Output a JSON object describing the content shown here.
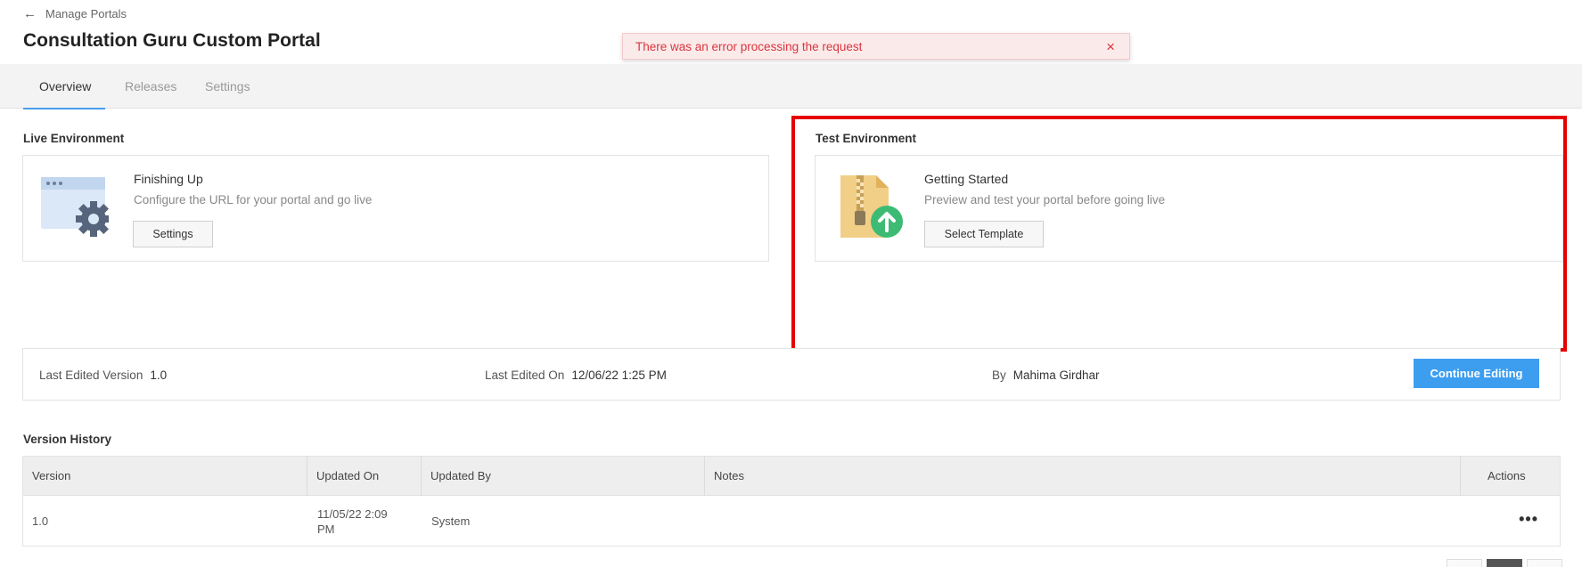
{
  "header": {
    "back_label": "Manage Portals",
    "title": "Consultation Guru Custom Portal"
  },
  "toast": {
    "message": "There was an error processing the request",
    "close_glyph": "×",
    "color": "#d8363e"
  },
  "tabs": [
    {
      "label": "Overview",
      "active": true
    },
    {
      "label": "Releases",
      "active": false
    },
    {
      "label": "Settings",
      "active": false
    }
  ],
  "live": {
    "section_label": "Live Environment",
    "title": "Finishing Up",
    "description": "Configure the URL for your portal and go live",
    "button": "Settings",
    "icon": "browser-gear-icon"
  },
  "test": {
    "section_label": "Test Environment",
    "title": "Getting Started",
    "description": "Preview and test your portal before going live",
    "button": "Select Template",
    "icon": "zip-upload-icon"
  },
  "edit_info": {
    "version_label": "Last Edited Version",
    "version_value": "1.0",
    "edited_on_label": "Last Edited On",
    "edited_on_value": "12/06/22 1:25 PM",
    "by_label": "By",
    "by_value": "Mahima Girdhar",
    "continue_button": "Continue Editing"
  },
  "version_history": {
    "label": "Version History",
    "columns": [
      "Version",
      "Updated On",
      "Updated By",
      "Notes",
      "Actions"
    ],
    "rows": [
      {
        "version": "1.0",
        "updated_on_line1": "11/05/22 2:09",
        "updated_on_line2": "PM",
        "updated_by": "System",
        "notes": "",
        "actions": "•••"
      }
    ]
  },
  "colors": {
    "accent": "#3d9ef0",
    "highlight": "#e60000",
    "tab_underline": "#4a9eea"
  }
}
